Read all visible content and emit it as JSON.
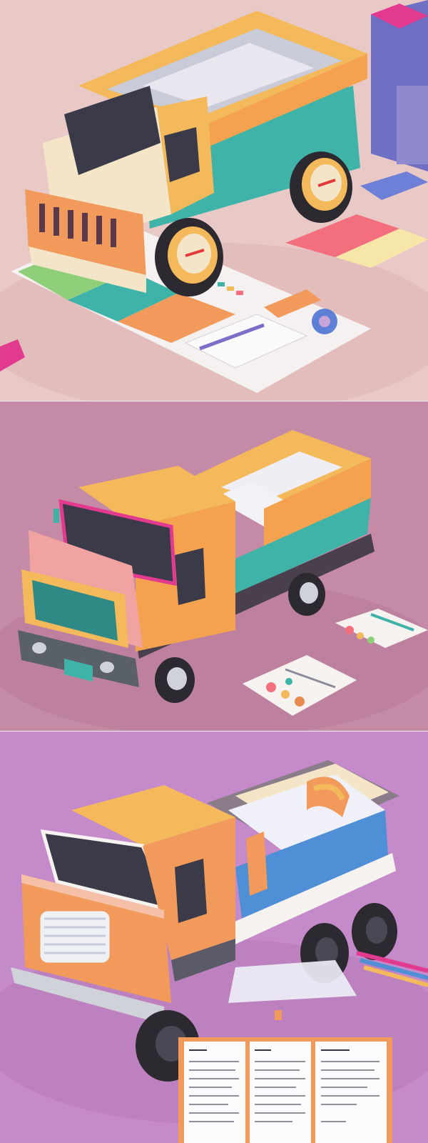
{
  "image": {
    "kind": "three stacked isometric illustrations of pastel toy trucks",
    "panels": [
      {
        "subject": "dump-truck",
        "background": "#e9c9c6"
      },
      {
        "subject": "flatbed-truck",
        "background": "#c58aa6"
      },
      {
        "subject": "bed-truck",
        "background": "#c58ac9"
      }
    ]
  },
  "colors": {
    "orange": "#f19a5c",
    "yellow": "#f4b95a",
    "teal": "#3fb3a8",
    "pink": "#f0a3a0",
    "cream": "#f4e5c8",
    "tire": "#2c2a30",
    "paper": "#f6f2f0",
    "magenta": "#e23a8f"
  }
}
